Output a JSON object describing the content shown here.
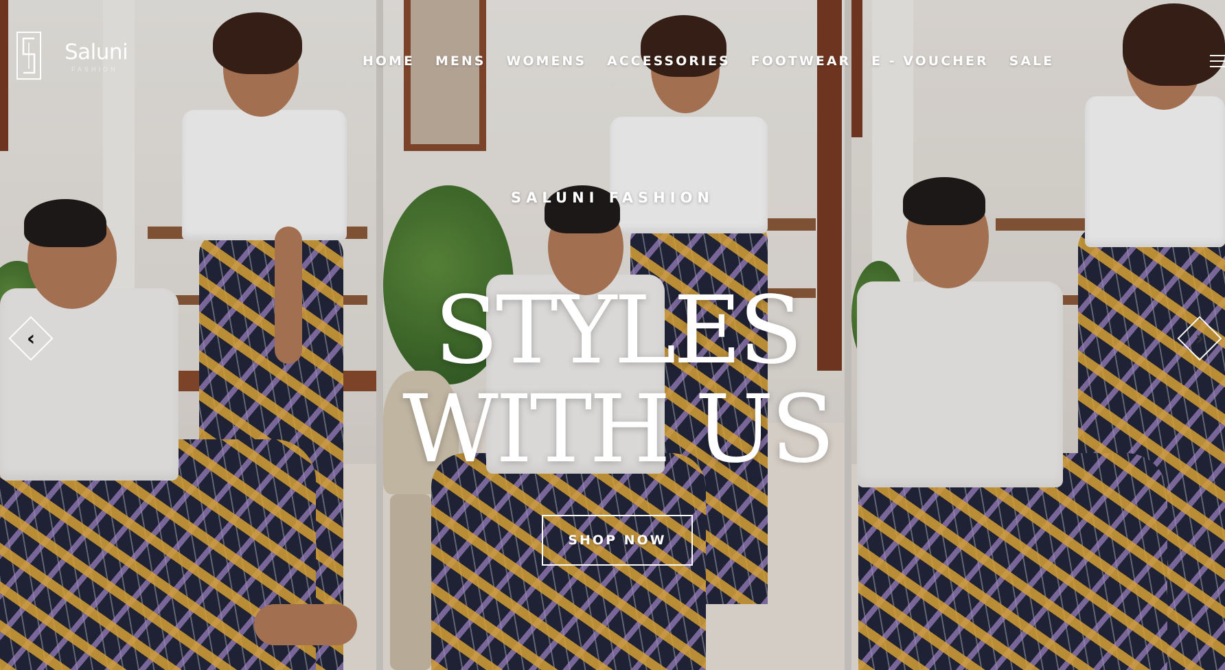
{
  "brand": {
    "name": "Saluni",
    "tagline": "FASHION",
    "logo_icon": "saluni-monogram-icon"
  },
  "nav": {
    "items": [
      {
        "label": "HOME"
      },
      {
        "label": "MENS"
      },
      {
        "label": "WOMENS"
      },
      {
        "label": "ACCESSORIES"
      },
      {
        "label": "FOOTWEAR"
      },
      {
        "label": "E - VOUCHER"
      },
      {
        "label": "SALE"
      }
    ],
    "menu_icon": "hamburger-icon"
  },
  "hero": {
    "eyebrow": "SALUNI FASHION",
    "headline_line1": "STYLES",
    "headline_line2": "WITH US",
    "cta_label": "SHOP NOW",
    "prev_icon": "chevron-left-icon",
    "next_icon": "chevron-right-icon",
    "prev_glyph": "‹",
    "next_glyph": "›"
  },
  "colors": {
    "text": "#ffffff",
    "print_base": "#22243a",
    "print_accent": "#f0b43c",
    "wood": "#7a3a22"
  }
}
